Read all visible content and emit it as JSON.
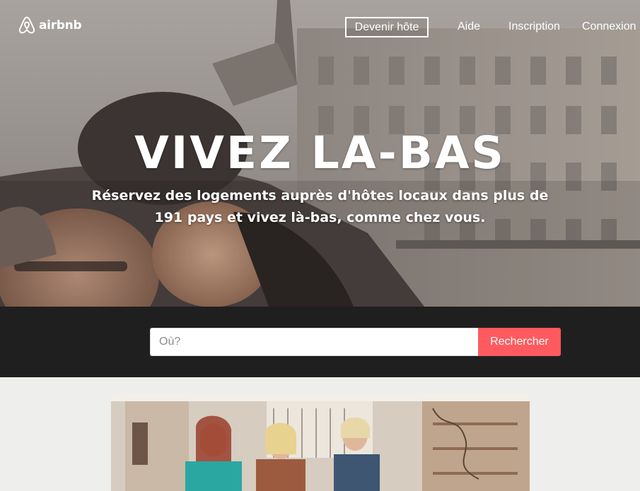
{
  "brand": {
    "name": "airbnb",
    "icon": "airbnb-logo-icon",
    "accent": "#ff5a5f"
  },
  "nav": {
    "host_label": "Devenir hôte",
    "help_label": "Aide",
    "signup_label": "Inscription",
    "login_label": "Connexion"
  },
  "hero": {
    "title": "VIVEZ LA-BAS",
    "subtitle": "Réservez des logements auprès d'hôtes locaux dans plus de 191 pays et vivez là-bas, comme chez vous."
  },
  "search": {
    "placeholder": "Où?",
    "value": "",
    "button_label": "Rechercher"
  }
}
